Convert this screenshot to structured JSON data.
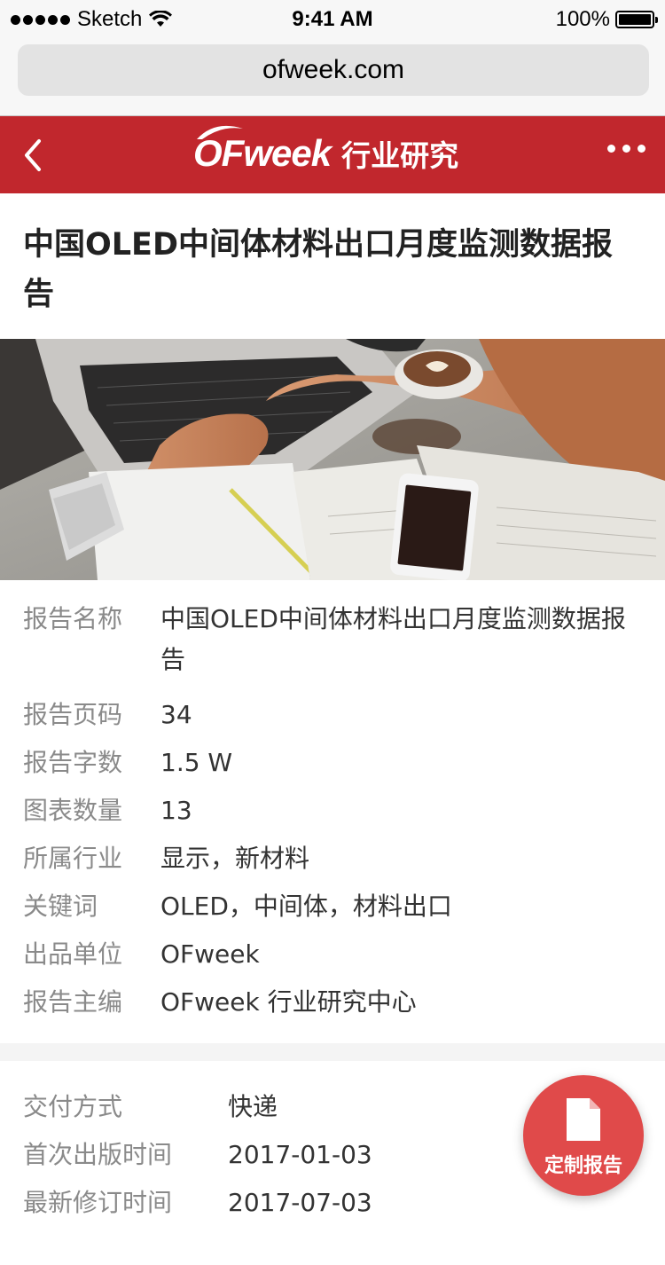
{
  "status_bar": {
    "carrier": "Sketch",
    "time": "9:41 AM",
    "battery": "100%"
  },
  "browser": {
    "url": "ofweek.com"
  },
  "header": {
    "logo_text": "OFweek",
    "subtitle": "行业研究",
    "back_icon": "chevron-left-icon",
    "more_icon": "more-horizontal-icon",
    "brand_color": "#c1272d"
  },
  "report": {
    "title": "中国OLED中间体材料出口月度监测数据报告"
  },
  "info": [
    {
      "label": "报告名称",
      "value": "中国OLED中间体材料出口月度监测数据报告"
    },
    {
      "label": "报告页码",
      "value": "34"
    },
    {
      "label": "报告字数",
      "value": "1.5 W"
    },
    {
      "label": "图表数量",
      "value": "13"
    },
    {
      "label": "所属行业",
      "value": "显示，新材料"
    },
    {
      "label": "关键词",
      "value": "OLED，中间体，材料出口"
    },
    {
      "label": "出品单位",
      "value": "OFweek"
    },
    {
      "label": "报告主编",
      "value": "OFweek 行业研究中心"
    }
  ],
  "delivery": [
    {
      "label": "交付方式",
      "value": "快递"
    },
    {
      "label": "首次出版时间",
      "value": "2017-01-03"
    },
    {
      "label": "最新修订时间",
      "value": "2017-07-03"
    }
  ],
  "fab": {
    "label": "定制报告",
    "icon": "document-icon",
    "color": "#e04a4a"
  }
}
